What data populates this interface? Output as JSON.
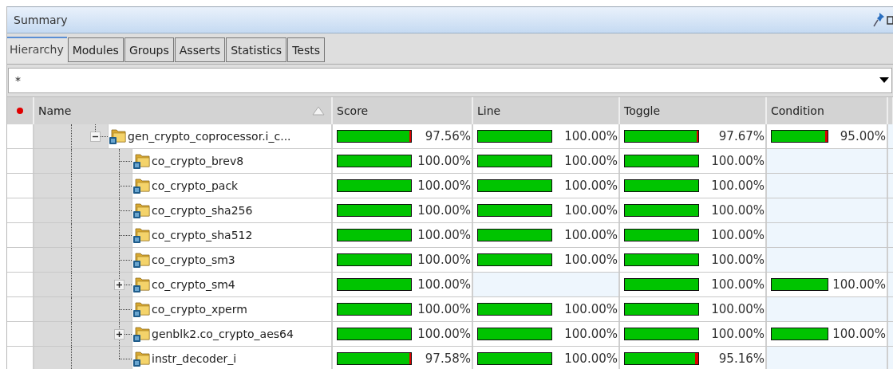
{
  "panel": {
    "title": "Summary"
  },
  "tabs": [
    {
      "label": "Hierarchy",
      "selected": true
    },
    {
      "label": "Modules",
      "selected": false
    },
    {
      "label": "Groups",
      "selected": false
    },
    {
      "label": "Asserts",
      "selected": false
    },
    {
      "label": "Statistics",
      "selected": false
    },
    {
      "label": "Tests",
      "selected": false
    }
  ],
  "filter": {
    "value": "*"
  },
  "table": {
    "columns": [
      "Name",
      "Score",
      "Line",
      "Toggle",
      "Condition"
    ],
    "rows": [
      {
        "name": "gen_crypto_coprocessor.i_c...",
        "expanded": true,
        "cells": [
          {
            "level": 0.9756,
            "text": "97.56%"
          },
          {
            "level": 1,
            "text": "100.00%"
          },
          {
            "level": 0.9767,
            "text": "97.67%"
          },
          {
            "level": 0.95,
            "text": "95.00%"
          }
        ],
        "children": [
          {
            "name": "co_crypto_brev8",
            "cells": [
              {
                "level": 1,
                "text": "100.00%"
              },
              {
                "level": 1,
                "text": "100.00%"
              },
              {
                "level": 1,
                "text": "100.00%"
              },
              null
            ]
          },
          {
            "name": "co_crypto_pack",
            "cells": [
              {
                "level": 1,
                "text": "100.00%"
              },
              {
                "level": 1,
                "text": "100.00%"
              },
              {
                "level": 1,
                "text": "100.00%"
              },
              null
            ]
          },
          {
            "name": "co_crypto_sha256",
            "cells": [
              {
                "level": 1,
                "text": "100.00%"
              },
              {
                "level": 1,
                "text": "100.00%"
              },
              {
                "level": 1,
                "text": "100.00%"
              },
              null
            ]
          },
          {
            "name": "co_crypto_sha512",
            "cells": [
              {
                "level": 1,
                "text": "100.00%"
              },
              {
                "level": 1,
                "text": "100.00%"
              },
              {
                "level": 1,
                "text": "100.00%"
              },
              null
            ]
          },
          {
            "name": "co_crypto_sm3",
            "cells": [
              {
                "level": 1,
                "text": "100.00%"
              },
              {
                "level": 1,
                "text": "100.00%"
              },
              {
                "level": 1,
                "text": "100.00%"
              },
              null
            ]
          },
          {
            "name": "co_crypto_sm4",
            "expanded": false,
            "cells": [
              {
                "level": 1,
                "text": "100.00%"
              },
              null,
              {
                "level": 1,
                "text": "100.00%"
              },
              {
                "level": 1,
                "text": "100.00%"
              }
            ]
          },
          {
            "name": "co_crypto_xperm",
            "cells": [
              {
                "level": 1,
                "text": "100.00%"
              },
              {
                "level": 1,
                "text": "100.00%"
              },
              {
                "level": 1,
                "text": "100.00%"
              },
              null
            ]
          },
          {
            "name": "genblk2.co_crypto_aes64",
            "expanded": false,
            "cells": [
              {
                "level": 1,
                "text": "100.00%"
              },
              {
                "level": 1,
                "text": "100.00%"
              },
              {
                "level": 1,
                "text": "100.00%"
              },
              {
                "level": 1,
                "text": "100.00%"
              }
            ]
          },
          {
            "name": "instr_decoder_i",
            "cells": [
              {
                "level": 0.9758,
                "text": "97.58%"
              },
              {
                "level": 1,
                "text": "100.00%"
              },
              {
                "level": 0.9516,
                "text": "95.16%"
              },
              null
            ]
          }
        ]
      }
    ]
  }
}
